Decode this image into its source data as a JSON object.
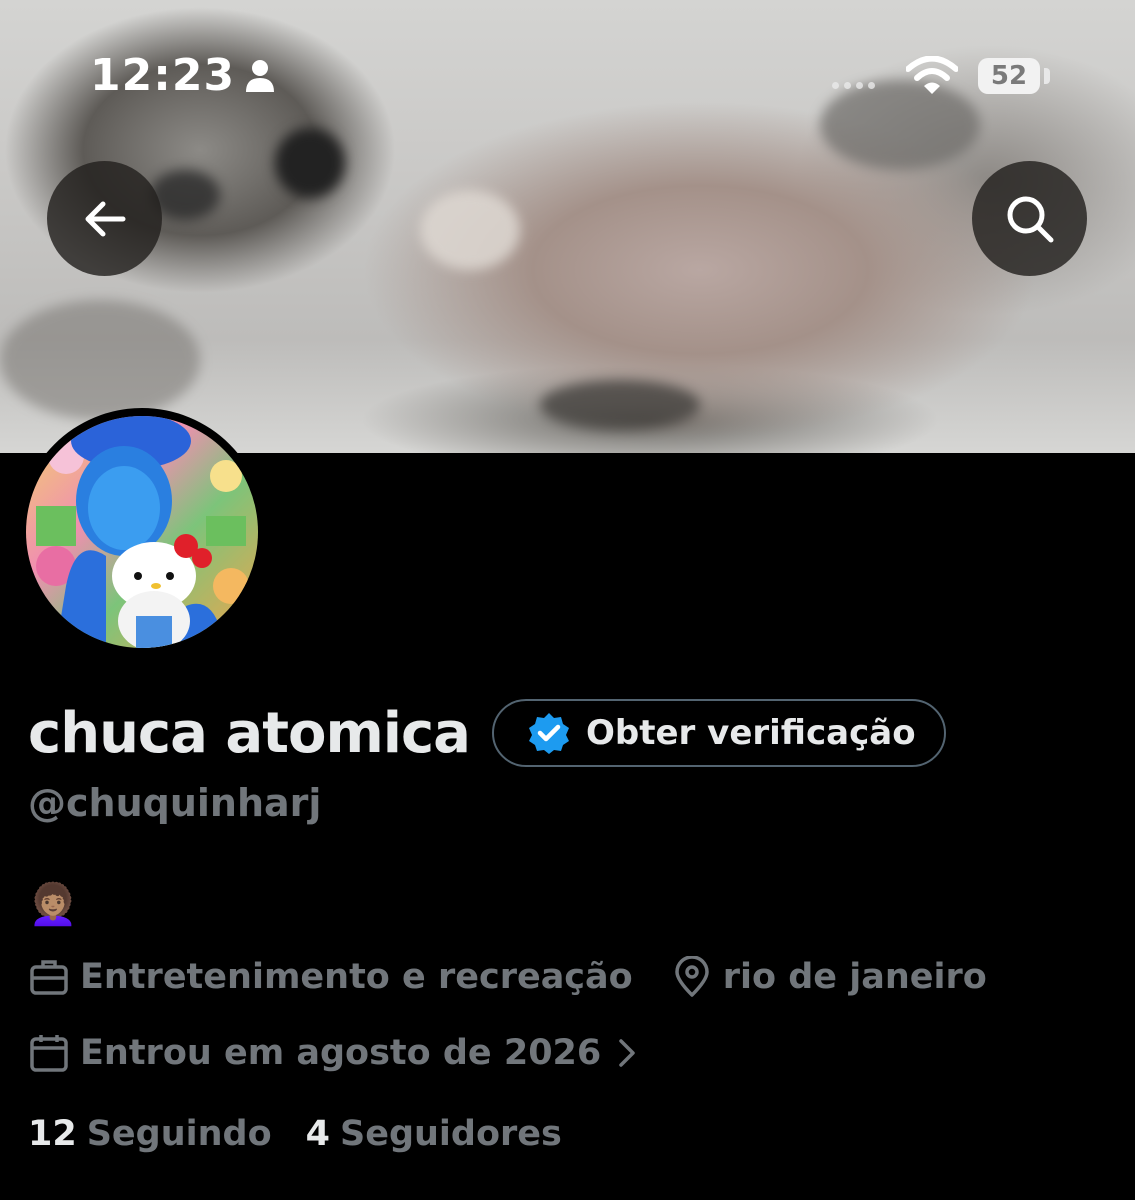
{
  "status_bar": {
    "time": "12:23",
    "battery": "52",
    "icons": [
      "person-icon",
      "signal-dots-icon",
      "wifi-icon",
      "battery-icon"
    ]
  },
  "nav": {
    "back_icon": "arrow-left-icon",
    "search_icon": "search-icon"
  },
  "profile": {
    "display_name": "chuca atomica",
    "verify_button_label": "Obter verificação",
    "handle": "@chuquinharj",
    "bio": "👩🏽‍🦱",
    "category": "Entretenimento e recreação",
    "location": "rio de janeiro",
    "joined": "Entrou em agosto de 2026",
    "following_count": "12",
    "following_label": "Seguindo",
    "followers_count": "4",
    "followers_label": "Seguidores"
  },
  "colors": {
    "background": "#000000",
    "text_primary": "#e7e9ea",
    "text_secondary": "#71767b",
    "verified_blue": "#1d9bf0",
    "border": "#536471"
  }
}
